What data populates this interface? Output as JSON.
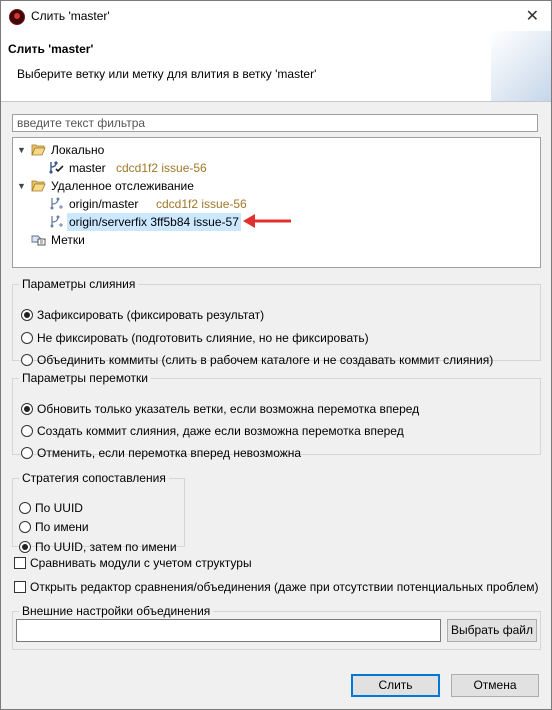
{
  "window": {
    "title": "Слить 'master'",
    "close_glyph": "✕"
  },
  "header": {
    "title": "Слить 'master'",
    "description": "Выберите ветку или метку для влития в ветку 'master'"
  },
  "filter": {
    "placeholder": "введите текст фильтра"
  },
  "tree": {
    "local": {
      "label": "Локально"
    },
    "local_master": {
      "name": "master",
      "meta": "cdcd1f2 issue-56"
    },
    "remote": {
      "label": "Удаленное отслеживание"
    },
    "origin_master": {
      "name": "origin/master",
      "meta": "cdcd1f2 issue-56"
    },
    "origin_serverfix": {
      "name": "origin/serverfix 3ff5b84 issue-57"
    },
    "tags": {
      "label": "Метки"
    }
  },
  "merge_options": {
    "legend": "Параметры слияния",
    "options": [
      "Зафиксировать (фиксировать результат)",
      "Не фиксировать (подготовить слияние, но не фиксировать)",
      "Объединить коммиты (слить в рабочем каталоге и не создавать коммит слияния)"
    ],
    "selected": 0
  },
  "ff_options": {
    "legend": "Параметры перемотки",
    "options": [
      "Обновить только указатель ветки, если возможна перемотка вперед",
      "Создать коммит слияния, даже если возможна перемотка вперед",
      "Отменить, если перемотка вперед невозможна"
    ],
    "selected": 0
  },
  "strategy": {
    "legend": "Стратегия сопоставления",
    "options": [
      "По UUID",
      "По имени",
      "По UUID, затем по имени"
    ],
    "selected": 2
  },
  "checkboxes": {
    "structure": {
      "label": "Сравнивать модули с учетом структуры",
      "checked": false
    },
    "open_editor": {
      "label": "Открыть редактор сравнения/объединения (даже при отсутствии потенциальных проблем)",
      "checked": false
    }
  },
  "external": {
    "legend": "Внешние настройки объединения",
    "value": "",
    "browse_label": "Выбрать файл"
  },
  "buttons": {
    "merge": "Слить",
    "cancel": "Отмена"
  },
  "colors": {
    "accent": "#0078d7",
    "selection": "#cce8ff",
    "meta": "#a0782a",
    "annotation_arrow": "#e03030"
  }
}
